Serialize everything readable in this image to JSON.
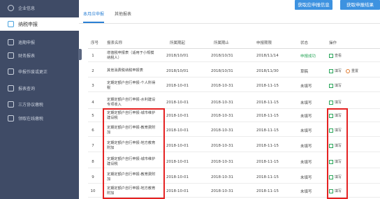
{
  "sidebar": {
    "items": [
      {
        "label": "企业信息",
        "icon": "user-circle-icon"
      },
      {
        "label": "纳税申报",
        "icon": "refresh-icon"
      },
      {
        "label": "逾期申报",
        "icon": "clock-icon"
      },
      {
        "label": "财务报表",
        "icon": "report-icon"
      },
      {
        "label": "申报作废或更正",
        "icon": "document-icon"
      },
      {
        "label": "报表查询",
        "icon": "search-icon"
      },
      {
        "label": "三方协议缴税",
        "icon": "agreement-icon"
      },
      {
        "label": "领取在线缴税",
        "icon": "wallet-icon"
      }
    ]
  },
  "tabs": [
    {
      "label": "本月应申报"
    },
    {
      "label": "其他报表"
    }
  ],
  "buttons": {
    "get_declaration_info": "获取应申报信息",
    "get_declaration_result": "获取申报结果"
  },
  "table": {
    "headers": [
      "序号",
      "报表名称",
      "所属期起",
      "所属期止",
      "申报期限",
      "状态",
      "操作"
    ],
    "rows": [
      {
        "no": "1",
        "name": "增值税申报表（适用于小规模纳税人）",
        "start": "2018/10/01",
        "end": "2018/10/31",
        "deadline": "2018/11/14",
        "status": "申报成功",
        "actions": [
          "查看"
        ]
      },
      {
        "no": "2",
        "name": "其他消费税纳税申报表",
        "start": "2018/10/01",
        "end": "2018/10/31",
        "deadline": "2018/11/30",
        "status": "草稿",
        "actions": [
          "填写",
          "重置"
        ]
      },
      {
        "no": "3",
        "name": "定期定额户自行申报-个人所得税",
        "start": "2018-10-01",
        "end": "2018-10-31",
        "deadline": "2018-11-15",
        "status": "未填写",
        "actions": [
          "填写"
        ]
      },
      {
        "no": "4",
        "name": "定期定额户自行申报-水利建设专项收入",
        "start": "2018-10-01",
        "end": "2018-10-31",
        "deadline": "2018-11-15",
        "status": "未填写",
        "actions": [
          "填写"
        ]
      },
      {
        "no": "5",
        "name": "定期定额户自行申报-城市维护建设税",
        "start": "2018-10-01",
        "end": "2018-10-31",
        "deadline": "2018-11-15",
        "status": "未填写",
        "actions": [
          "填写"
        ]
      },
      {
        "no": "6",
        "name": "定期定额户自行申报-教育费附加",
        "start": "2018-10-01",
        "end": "2018-10-31",
        "deadline": "2018-11-15",
        "status": "未填写",
        "actions": [
          "填写"
        ]
      },
      {
        "no": "7",
        "name": "定期定额户自行申报-地方教育附加",
        "start": "2018-10-01",
        "end": "2018-10-31",
        "deadline": "2018-11-15",
        "status": "未填写",
        "actions": [
          "填写"
        ]
      },
      {
        "no": "8",
        "name": "定期定额户自行申报-城市维护建设税",
        "start": "2018-10-01",
        "end": "2018-10-31",
        "deadline": "2018-11-15",
        "status": "未填写",
        "actions": [
          "填写"
        ]
      },
      {
        "no": "9",
        "name": "定期定额户自行申报-教育费附加",
        "start": "2018-10-01",
        "end": "2018-10-31",
        "deadline": "2018-11-15",
        "status": "未填写",
        "actions": [
          "填写"
        ]
      },
      {
        "no": "10",
        "name": "定期定额户自行申报-地方教育附加",
        "start": "2018-10-01",
        "end": "2018-10-31",
        "deadline": "2018-11-15",
        "status": "未填写",
        "actions": [
          "填写"
        ]
      }
    ]
  },
  "colors": {
    "sidebar_bg": "#3f4b66",
    "accent": "#3d92e0",
    "success": "#2aa65a",
    "highlight": "#e52222"
  }
}
